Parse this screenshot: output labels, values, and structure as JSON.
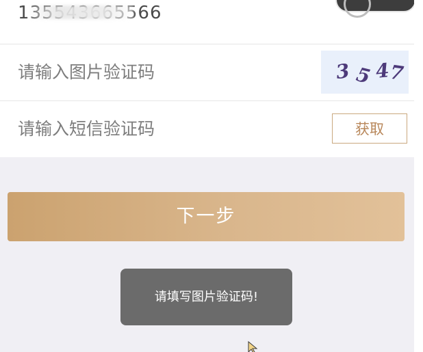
{
  "form": {
    "phone_value": "135543665566",
    "image_captcha_placeholder": "请输入图片验证码",
    "captcha_text": [
      "3",
      "5",
      "4",
      "7"
    ],
    "sms_code_placeholder": "请输入短信验证码",
    "get_code_label": "获取"
  },
  "actions": {
    "next_label": "下一步"
  },
  "toast": {
    "message": "请填写图片验证码!"
  },
  "colors": {
    "accent": "#c9a77d",
    "button_gradient_start": "#cba26f",
    "button_gradient_end": "#e2c199",
    "toast_bg": "#6b6b6b",
    "page_bg": "#f0eff4"
  },
  "icons": {
    "pointer": "arrow-cursor-icon",
    "float_widget": "floating-assist-icon"
  }
}
